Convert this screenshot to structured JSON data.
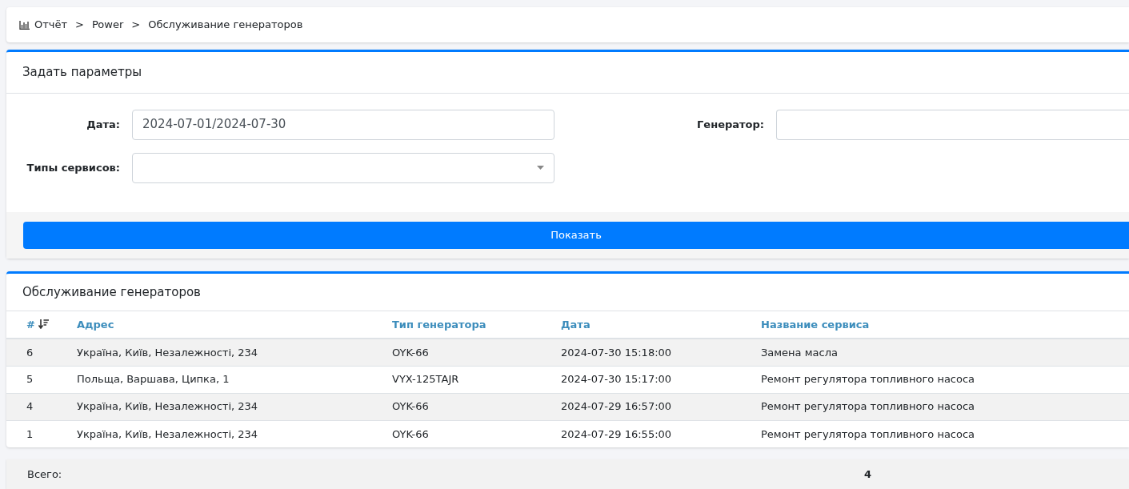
{
  "breadcrumb": [
    "Отчёт",
    "Power",
    "Обслуживание генераторов"
  ],
  "breadcrumb_separator": ">",
  "params": {
    "title": "Задать параметры",
    "fields": [
      {
        "kind": "text",
        "label": "Дата:",
        "value": "2024-07-01/2024-07-30"
      },
      {
        "kind": "text",
        "label": "Генератор:"
      },
      {
        "kind": "select",
        "label": "Типы сервисов:"
      }
    ],
    "button": "Показать"
  },
  "table": {
    "title": "Обслуживание генераторов",
    "columns": [
      {
        "label": "#",
        "sorted": true
      },
      {
        "label": "Адрес",
        "sorted": false
      },
      {
        "label": "Тип генератора",
        "sorted": false
      },
      {
        "label": "Дата",
        "sorted": false
      },
      {
        "label": "Название сервиса",
        "sorted": false
      }
    ],
    "rows": [
      [
        "6",
        "Україна, Київ, Незалежності, 234",
        "OYK-66",
        "2024-07-30 15:18:00",
        "Замена масла"
      ],
      [
        "5",
        "Польща, Варшава, Ципка, 1",
        "VYX-125TAJR",
        "2024-07-30 15:17:00",
        "Ремонт регулятора топливного насоса"
      ],
      [
        "4",
        "Україна, Київ, Незалежності, 234",
        "OYK-66",
        "2024-07-29 16:57:00",
        "Ремонт регулятора топливного насоса"
      ],
      [
        "1",
        "Україна, Київ, Незалежності, 234",
        "OYK-66",
        "2024-07-29 16:55:00",
        "Ремонт регулятора топливного насоса"
      ]
    ]
  },
  "total": {
    "label": "Всего:",
    "value": "4"
  }
}
